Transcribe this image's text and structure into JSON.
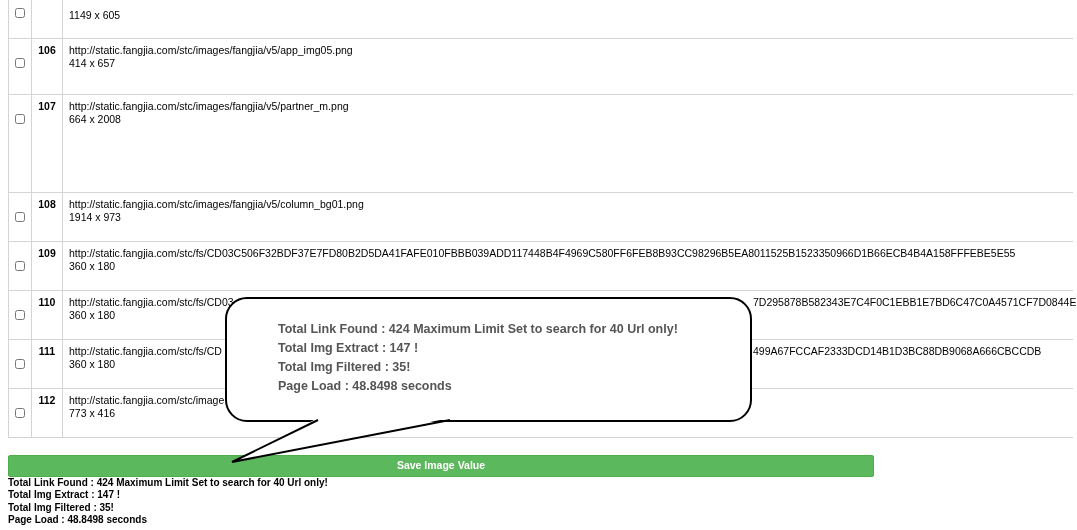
{
  "image_table": {
    "rows": [
      {
        "checked": false,
        "size": "1149 x 605"
      },
      {
        "checked": false,
        "number": "106",
        "url": "http://static.fangjia.com/stc/images/fangjia/v5/app_img05.png",
        "size": "414 x 657"
      },
      {
        "checked": false,
        "number": "107",
        "url": "http://static.fangjia.com/stc/images/fangjia/v5/partner_m.png",
        "size": "664 x 2008",
        "tall": true
      },
      {
        "checked": false,
        "number": "108",
        "url": "http://static.fangjia.com/stc/images/fangjia/v5/column_bg01.png",
        "size": "1914 x 973"
      },
      {
        "checked": false,
        "number": "109",
        "url": "http://static.fangjia.com/stc/fs/CD03C506F32BDF37E7FD80B2D5DA41FAFE010FBBB039ADD117448B4F4969C580FF6FEB8B93CC98296B5EA8011525B1523350966D1B66ECB4B4A158FFFEBE5E55",
        "size": "360 x 180"
      },
      {
        "checked": false,
        "number": "110",
        "url": "http://static.fangjia.com/stc/fs/CD03",
        "url_end": "7D295878B582343E7C4F0C1EBB1E7BD6C47C0A4571CF7D0844E",
        "size": "360 x 180"
      },
      {
        "checked": false,
        "number": "111",
        "url": "http://static.fangjia.com/stc/fs/CD",
        "url_end": "499A67FCCAF2333DCD14B1D3BC88DB9068A666CBCCDB",
        "size": "360 x 180"
      },
      {
        "checked": false,
        "number": "112",
        "url": "http://static.fangjia.com/stc/image",
        "size": "773 x 416"
      }
    ]
  },
  "callout": {
    "lines": [
      "Total Link Found : 424 Maximum Limit Set to search for 40 Url only!",
      "Total Img Extract : 147 !",
      "Total Img Filtered : 35!",
      "Page Load : 48.8498 seconds"
    ]
  },
  "save_button": {
    "label": "Save Image Value"
  },
  "summary": {
    "lines": [
      "Total Link Found : 424 Maximum Limit Set to search for 40 Url only!",
      "Total Img Extract : 147 !",
      "Total Img Filtered : 35!",
      "Page Load : 48.8498 seconds"
    ]
  }
}
